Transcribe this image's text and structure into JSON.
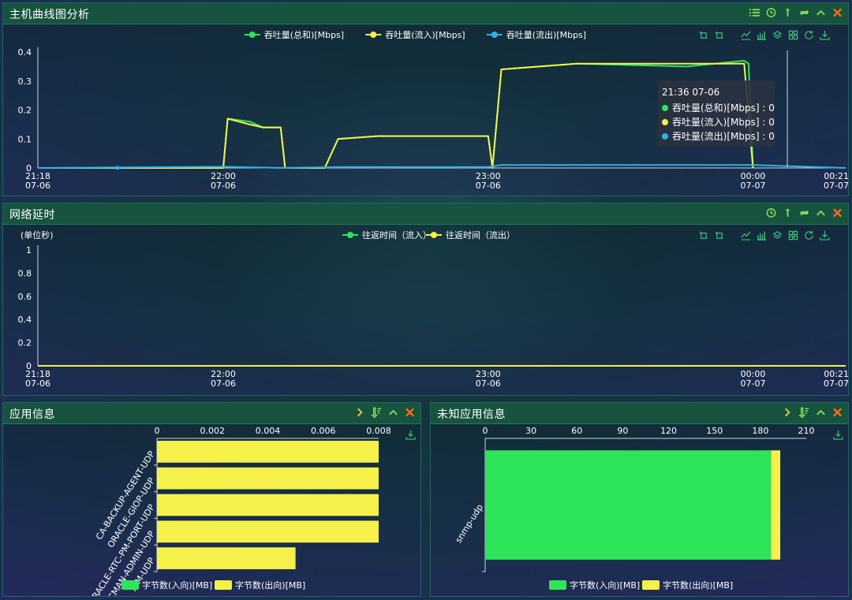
{
  "panels": {
    "host_curve": {
      "title": "主机曲线图分析",
      "legend": [
        "吞吐量(总和)[Mbps]",
        "吞吐量(流入)[Mbps]",
        "吞吐量(流出)[Mbps]"
      ],
      "tooltip": {
        "time": "21:36 07-06",
        "rows": [
          "吞吐量(总和)[Mbps] : 0",
          "吞吐量(流入)[Mbps] : 0",
          "吞吐量(流出)[Mbps] : 0"
        ]
      }
    },
    "latency": {
      "title": "网络延时",
      "unit": "(单位秒)",
      "legend": [
        "往返时间（流入）",
        "往返时间（流出）"
      ]
    },
    "app_info": {
      "title": "应用信息",
      "legend": [
        "字节数(入向)[MB]",
        "字节数(出向)[MB]"
      ]
    },
    "unknown_app": {
      "title": "未知应用信息",
      "legend": [
        "字节数(入向)[MB]",
        "字节数(出向)[MB]"
      ]
    }
  },
  "icons": {
    "head": [
      "list-icon",
      "clock-icon",
      "sort-icon",
      "refresh-icon",
      "collapse-icon",
      "close-icon"
    ],
    "tools": [
      "zoom-icon",
      "zoom-reset-icon",
      "line-chart-icon",
      "bar-chart-icon",
      "stack-icon",
      "tiled-icon",
      "restore-icon",
      "download-icon"
    ]
  },
  "colors": {
    "total": "#2ee55a",
    "in": "#f5f04a",
    "out": "#2bb3e6",
    "header": "#17533f",
    "accent_orange": "#f5a623",
    "close": "#ff6a1a"
  },
  "chart_data": [
    {
      "type": "line",
      "x_ticks": [
        "21:18\n07-06",
        "22:00\n07-06",
        "23:00\n07-06",
        "00:00\n07-07",
        "00:21\n07-07"
      ],
      "ylim": [
        0,
        0.4
      ],
      "y_ticks": [
        "0",
        "0.1",
        "0.2",
        "0.3",
        "0.4"
      ],
      "series": [
        {
          "name": "吞吐量(总和)[Mbps]",
          "points": [
            [
              "21:18",
              0
            ],
            [
              "22:00",
              0
            ],
            [
              "22:01",
              0.17
            ],
            [
              "22:06",
              0.16
            ],
            [
              "22:09",
              0.14
            ],
            [
              "22:12",
              0.14
            ],
            [
              "22:13",
              0.14
            ],
            [
              "22:14",
              0
            ],
            [
              "22:23",
              0
            ],
            [
              "22:26",
              0.1
            ],
            [
              "22:35",
              0.11
            ],
            [
              "22:50",
              0.11
            ],
            [
              "23:00",
              0.11
            ],
            [
              "23:01",
              0
            ],
            [
              "23:03",
              0.34
            ],
            [
              "23:20",
              0.36
            ],
            [
              "23:45",
              0.35
            ],
            [
              "23:58",
              0.37
            ],
            [
              "23:59",
              0.36
            ],
            [
              "00:00",
              0
            ]
          ]
        },
        {
          "name": "吞吐量(流入)[Mbps]",
          "points": [
            [
              "21:18",
              0
            ],
            [
              "22:00",
              0
            ],
            [
              "22:01",
              0.17
            ],
            [
              "22:06",
              0.15
            ],
            [
              "22:09",
              0.14
            ],
            [
              "22:13",
              0.14
            ],
            [
              "22:14",
              0
            ],
            [
              "22:23",
              0
            ],
            [
              "22:26",
              0.1
            ],
            [
              "22:35",
              0.11
            ],
            [
              "23:00",
              0.11
            ],
            [
              "23:01",
              0
            ],
            [
              "23:03",
              0.34
            ],
            [
              "23:20",
              0.36
            ],
            [
              "23:58",
              0.36
            ],
            [
              "00:00",
              0
            ]
          ]
        },
        {
          "name": "吞吐量(流出)[Mbps]",
          "points": [
            [
              "21:18",
              0
            ],
            [
              "22:00",
              0.004
            ],
            [
              "22:14",
              0
            ],
            [
              "22:26",
              0.003
            ],
            [
              "23:00",
              0.003
            ],
            [
              "23:03",
              0.01
            ],
            [
              "00:00",
              0.01
            ],
            [
              "00:21",
              0
            ]
          ]
        }
      ]
    },
    {
      "type": "line",
      "x_ticks": [
        "21:18\n07-06",
        "22:00\n07-06",
        "23:00\n07-06",
        "00:00\n07-07",
        "00:21\n07-07"
      ],
      "ylim": [
        0,
        1
      ],
      "y_ticks": [
        "0",
        "0.2",
        "0.4",
        "0.6",
        "0.8",
        "1"
      ],
      "ylabel": "(单位秒)",
      "series": [
        {
          "name": "往返时间（流入）",
          "values_constant": 0
        },
        {
          "name": "往返时间（流出）",
          "values_constant": 0
        }
      ]
    },
    {
      "type": "bar",
      "orientation": "horizontal",
      "categories": [
        "CA-BACKUP-AGENT-UDP",
        "ORACLE-GIOP-UDP",
        "ORACLE-RTC-PM-PORT-UDP",
        "NETB-CMAN-ADMIN-UDP",
        "AIM-UDP"
      ],
      "x_ticks": [
        "0",
        "0.002",
        "0.004",
        "0.006",
        "0.008"
      ],
      "xlim": [
        0,
        0.008
      ],
      "series": [
        {
          "name": "字节数(入向)[MB]",
          "values": [
            0,
            0,
            0,
            0,
            0
          ]
        },
        {
          "name": "字节数(出向)[MB]",
          "values": [
            0.008,
            0.008,
            0.008,
            0.008,
            0.005
          ]
        }
      ]
    },
    {
      "type": "bar",
      "orientation": "horizontal",
      "categories": [
        "snmp-udp"
      ],
      "x_ticks": [
        "0",
        "30",
        "60",
        "90",
        "120",
        "150",
        "180",
        "210"
      ],
      "xlim": [
        0,
        210
      ],
      "series": [
        {
          "name": "字节数(入向)[MB]",
          "values": [
            187
          ]
        },
        {
          "name": "字节数(出向)[MB]",
          "values": [
            6
          ]
        }
      ]
    }
  ]
}
